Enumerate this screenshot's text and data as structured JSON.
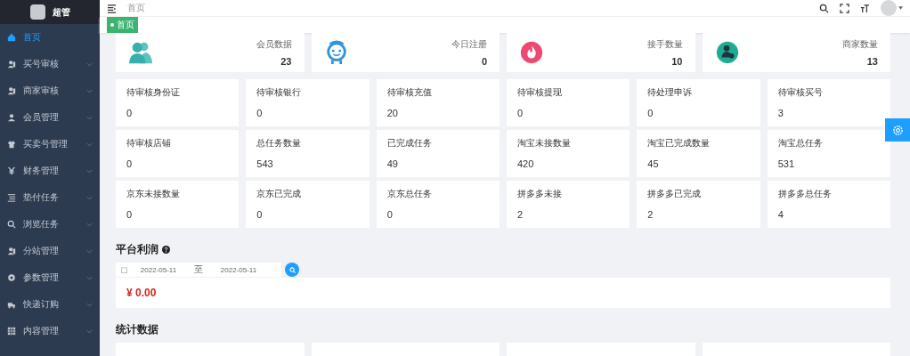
{
  "brand": {
    "name": "超管"
  },
  "sidebar": {
    "items": [
      {
        "label": "首页",
        "selected": true,
        "expandable": false
      },
      {
        "label": "买号审核",
        "selected": false,
        "expandable": true
      },
      {
        "label": "商家审核",
        "selected": false,
        "expandable": true
      },
      {
        "label": "会员管理",
        "selected": false,
        "expandable": true
      },
      {
        "label": "买卖号管理",
        "selected": false,
        "expandable": true
      },
      {
        "label": "财务管理",
        "selected": false,
        "expandable": true
      },
      {
        "label": "垫付任务",
        "selected": false,
        "expandable": true
      },
      {
        "label": "浏览任务",
        "selected": false,
        "expandable": true
      },
      {
        "label": "分站管理",
        "selected": false,
        "expandable": true
      },
      {
        "label": "参数管理",
        "selected": false,
        "expandable": true
      },
      {
        "label": "快递订购",
        "selected": false,
        "expandable": true
      },
      {
        "label": "内容管理",
        "selected": false,
        "expandable": true
      }
    ]
  },
  "header": {
    "breadcrumb": "首页"
  },
  "tabs": [
    {
      "label": "首页",
      "selected": true
    }
  ],
  "summary_cards": [
    {
      "label": "会员数据",
      "value": "23"
    },
    {
      "label": "今日注册",
      "value": "0"
    },
    {
      "label": "接手数量",
      "value": "10"
    },
    {
      "label": "商家数量",
      "value": "13"
    }
  ],
  "stats": [
    {
      "label": "待审核身份证",
      "value": "0"
    },
    {
      "label": "待审核银行",
      "value": "0"
    },
    {
      "label": "待审核充值",
      "value": "20"
    },
    {
      "label": "待审核提现",
      "value": "0"
    },
    {
      "label": "待处理申诉",
      "value": "0"
    },
    {
      "label": "待审核买号",
      "value": "3"
    },
    {
      "label": "待审核店铺",
      "value": "0"
    },
    {
      "label": "总任务数量",
      "value": "543"
    },
    {
      "label": "已完成任务",
      "value": "49"
    },
    {
      "label": "淘宝未接数量",
      "value": "420"
    },
    {
      "label": "淘宝已完成数量",
      "value": "45"
    },
    {
      "label": "淘宝总任务",
      "value": "531"
    },
    {
      "label": "京东未接数量",
      "value": "0"
    },
    {
      "label": "京东已完成",
      "value": "0"
    },
    {
      "label": "京东总任务",
      "value": "0"
    },
    {
      "label": "拼多多未接",
      "value": "2"
    },
    {
      "label": "拼多多已完成",
      "value": "2"
    },
    {
      "label": "拼多多总任务",
      "value": "4"
    }
  ],
  "profit": {
    "title": "平台利润",
    "start_date": "2022-05-11",
    "separator": "至",
    "end_date": "2022-05-11",
    "amount": "¥ 0.00"
  },
  "statistics": {
    "title": "统计数据"
  }
}
